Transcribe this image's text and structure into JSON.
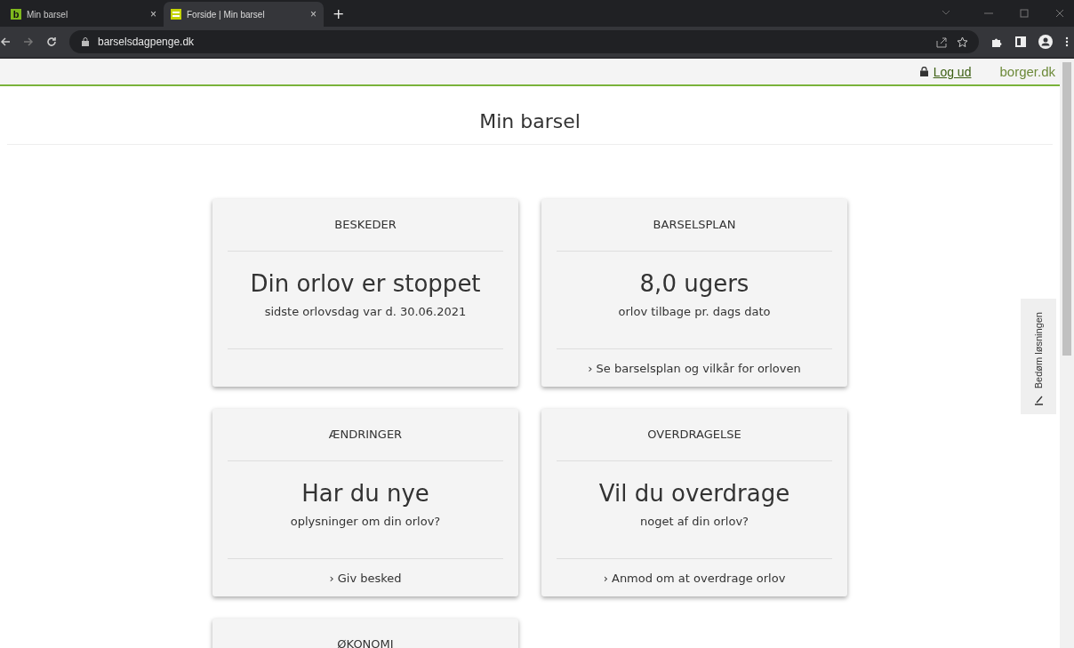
{
  "browser": {
    "tabs": [
      {
        "title": "Min barsel",
        "favicon": "b",
        "selected": false
      },
      {
        "title": "Forside | Min barsel",
        "selected": true
      }
    ],
    "new_tab": "+",
    "close": "×",
    "url": "barselsdagpenge.dk"
  },
  "header": {
    "logout": "Log ud",
    "brand": "borger.dk"
  },
  "page_title": "Min barsel",
  "cards": [
    {
      "heading": "BESKEDER",
      "headline": "Din orlov er stoppet",
      "subtext": "sidste orlovsdag var d. 30.06.2021"
    },
    {
      "heading": "BARSELSPLAN",
      "headline": "8,0 ugers",
      "subtext": "orlov tilbage pr. dags dato",
      "link": "› Se barselsplan og vilkår for orloven"
    },
    {
      "heading": "ÆNDRINGER",
      "headline": "Har du nye",
      "subtext": "oplysninger om din orlov?",
      "link": "› Giv besked"
    },
    {
      "heading": "OVERDRAGELSE",
      "headline": "Vil du overdrage",
      "subtext": "noget af din orlov?",
      "link": "› Anmod om at overdrage orlov"
    },
    {
      "heading": "ØKONOMI"
    }
  ],
  "feedback_tab": "Bedøm løsningen"
}
